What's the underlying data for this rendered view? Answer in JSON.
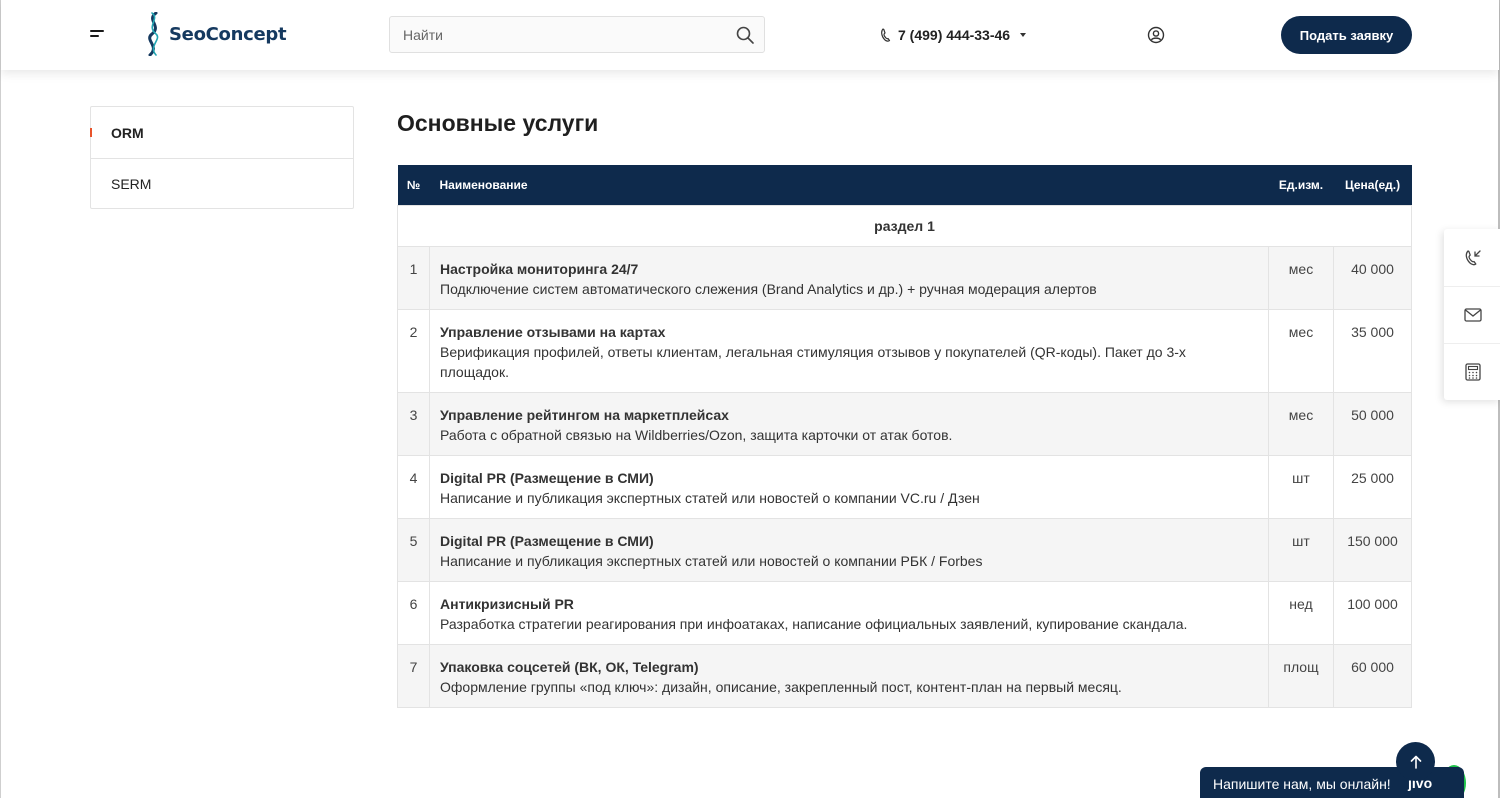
{
  "header": {
    "logo_text": "SeoConcept",
    "search_placeholder": "Найти",
    "phone": "7 (499) 444-33-46",
    "cta_label": "Подать заявку"
  },
  "sidebar": {
    "items": [
      {
        "label": "ORM",
        "active": true
      },
      {
        "label": "SERM",
        "active": false
      }
    ]
  },
  "main": {
    "title": "Основные услуги",
    "table": {
      "headers": {
        "no": "№",
        "name": "Наименование",
        "unit": "Ед.изм.",
        "price": "Цена(ед.)"
      },
      "section": "раздел 1",
      "rows": [
        {
          "no": "1",
          "name": "Настройка мониторинга 24/7",
          "desc": "Подключение систем автоматического слежения (Brand Analytics и др.) + ручная модерация алертов",
          "unit": "мес",
          "price": "40 000"
        },
        {
          "no": "2",
          "name": "Управление отзывами на картах",
          "desc": "Верификация профилей, ответы клиентам, легальная стимуляция отзывов у покупателей (QR-коды). Пакет до 3-х площадок.",
          "unit": "мес",
          "price": "35 000"
        },
        {
          "no": "3",
          "name": "Управление рейтингом на маркетплейсах",
          "desc": "Работа с обратной связью на Wildberries/Ozon, защита карточки от атак ботов.",
          "unit": "мес",
          "price": "50 000"
        },
        {
          "no": "4",
          "name": "Digital PR (Размещение в СМИ)",
          "desc": "Написание и публикация экспертных статей или новостей о компании VC.ru / Дзен",
          "unit": "шт",
          "price": "25 000"
        },
        {
          "no": "5",
          "name": "Digital PR (Размещение в СМИ)",
          "desc": "Написание и публикация экспертных статей или новостей о компании РБК / Forbes",
          "unit": "шт",
          "price": "150 000"
        },
        {
          "no": "6",
          "name": "Антикризисный PR",
          "desc": "Разработка стратегии реагирования при инфоатаках, написание официальных заявлений, купирование скандала.",
          "unit": "нед",
          "price": "100 000"
        },
        {
          "no": "7",
          "name": "Упаковка соцсетей (ВК, ОК, Telegram)",
          "desc": "Оформление группы «под ключ»: дизайн, описание, закрепленный пост, контент-план на первый месяц.",
          "unit": "площ",
          "price": "60 000"
        }
      ]
    }
  },
  "float_panel": {
    "icons": [
      "phone-callback-icon",
      "mail-icon",
      "calculator-icon"
    ]
  },
  "chat": {
    "text": "Напишите нам, мы онлайн!",
    "brand": "jivo"
  },
  "colors": {
    "primary_dark": "#0e2a4c",
    "accent": "#e8532b",
    "jivo_green": "#1fc44a"
  }
}
